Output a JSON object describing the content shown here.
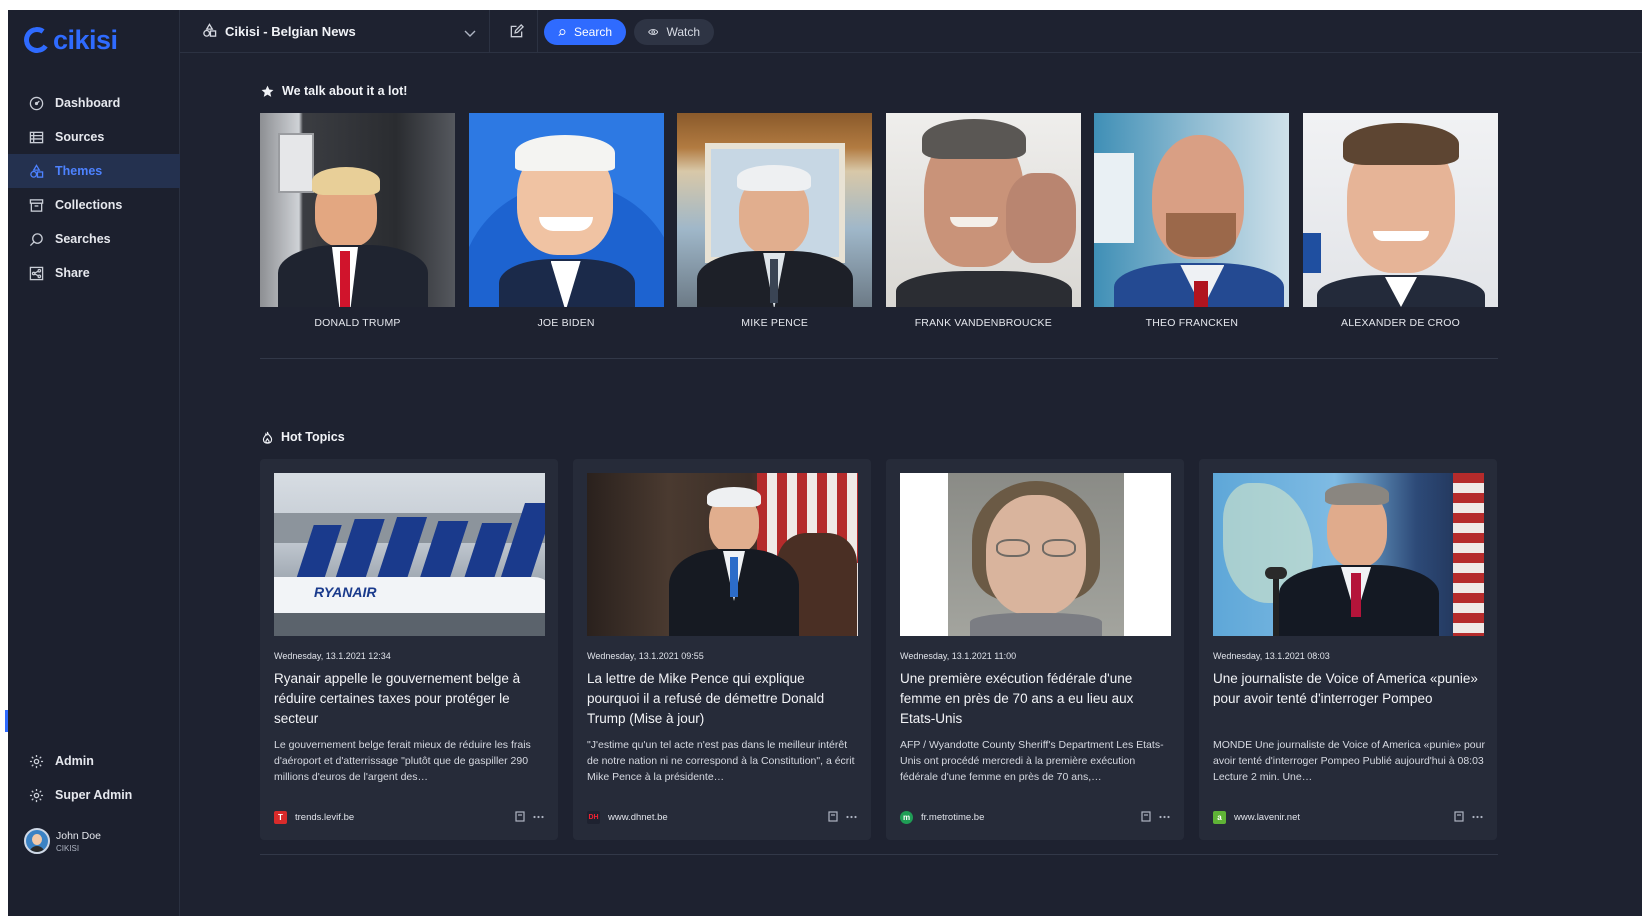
{
  "app": {
    "logo_text": "cikisi",
    "brand_color": "#2f6bff"
  },
  "topbar": {
    "project_title": "Cikisi - Belgian News",
    "search_label": "Search",
    "watch_label": "Watch"
  },
  "sidebar": {
    "items": [
      {
        "label": "Dashboard",
        "icon": "dashboard-icon"
      },
      {
        "label": "Sources",
        "icon": "sources-icon"
      },
      {
        "label": "Themes",
        "icon": "themes-icon",
        "active": true
      },
      {
        "label": "Collections",
        "icon": "collections-icon"
      },
      {
        "label": "Searches",
        "icon": "search-icon"
      },
      {
        "label": "Share",
        "icon": "share-icon"
      }
    ],
    "bottom_items": [
      {
        "label": "Admin",
        "icon": "gear-icon"
      },
      {
        "label": "Super Admin",
        "icon": "gear-icon"
      }
    ],
    "user": {
      "name": "John Doe",
      "org": "CIKISI"
    }
  },
  "people_section": {
    "title": "We talk about it a lot!",
    "people": [
      {
        "name": "DONALD TRUMP"
      },
      {
        "name": "JOE BIDEN"
      },
      {
        "name": "MIKE PENCE"
      },
      {
        "name": "FRANK VANDENBROUCKE"
      },
      {
        "name": "THEO FRANCKEN"
      },
      {
        "name": "ALEXANDER DE CROO"
      }
    ]
  },
  "hot_topics": {
    "title": "Hot Topics",
    "articles": [
      {
        "date": "Wednesday, 13.1.2021 12:34",
        "headline": "Ryanair appelle le gouvernement belge à réduire certaines taxes pour protéger le secteur",
        "snippet": "Le gouvernement belge ferait mieux de réduire les frais d'aéroport et d'atterrissage \"plutôt que de gaspiller 290 millions d'euros de l'argent des…",
        "source": "trends.levif.be",
        "fav": "T",
        "fav_color": "#d92b2b"
      },
      {
        "date": "Wednesday, 13.1.2021 09:55",
        "headline": "La lettre de Mike Pence qui explique pourquoi il a refusé de démettre Donald Trump (Mise à jour)",
        "snippet": "\"J'estime qu'un tel acte n'est pas dans le meilleur intérêt de notre nation ni ne correspond à la Constitution\", a écrit Mike Pence à la présidente…",
        "source": "www.dhnet.be",
        "fav": "DH",
        "fav_color": "#c8102e"
      },
      {
        "date": "Wednesday, 13.1.2021 11:00",
        "headline": "Une première exécution fédérale d'une femme en près de 70 ans a eu lieu aux Etats-Unis",
        "snippet": "AFP / Wyandotte County Sheriff's Department Les Etats-Unis ont procédé mercredi à la première exécution fédérale d'une femme en près de 70 ans,…",
        "source": "fr.metrotime.be",
        "fav": "m",
        "fav_color": "#1f9d55"
      },
      {
        "date": "Wednesday, 13.1.2021 08:03",
        "headline": "Une journaliste de Voice of America «punie» pour avoir tenté d'interroger Pompeo",
        "snippet": "MONDE Une journaliste de Voice of America «punie» pour avoir tenté d'interroger Pompeo Publié aujourd'hui à 08:03 Lecture 2 min. Une…",
        "source": "www.lavenir.net",
        "fav": "a",
        "fav_color": "#5fb336"
      }
    ]
  }
}
